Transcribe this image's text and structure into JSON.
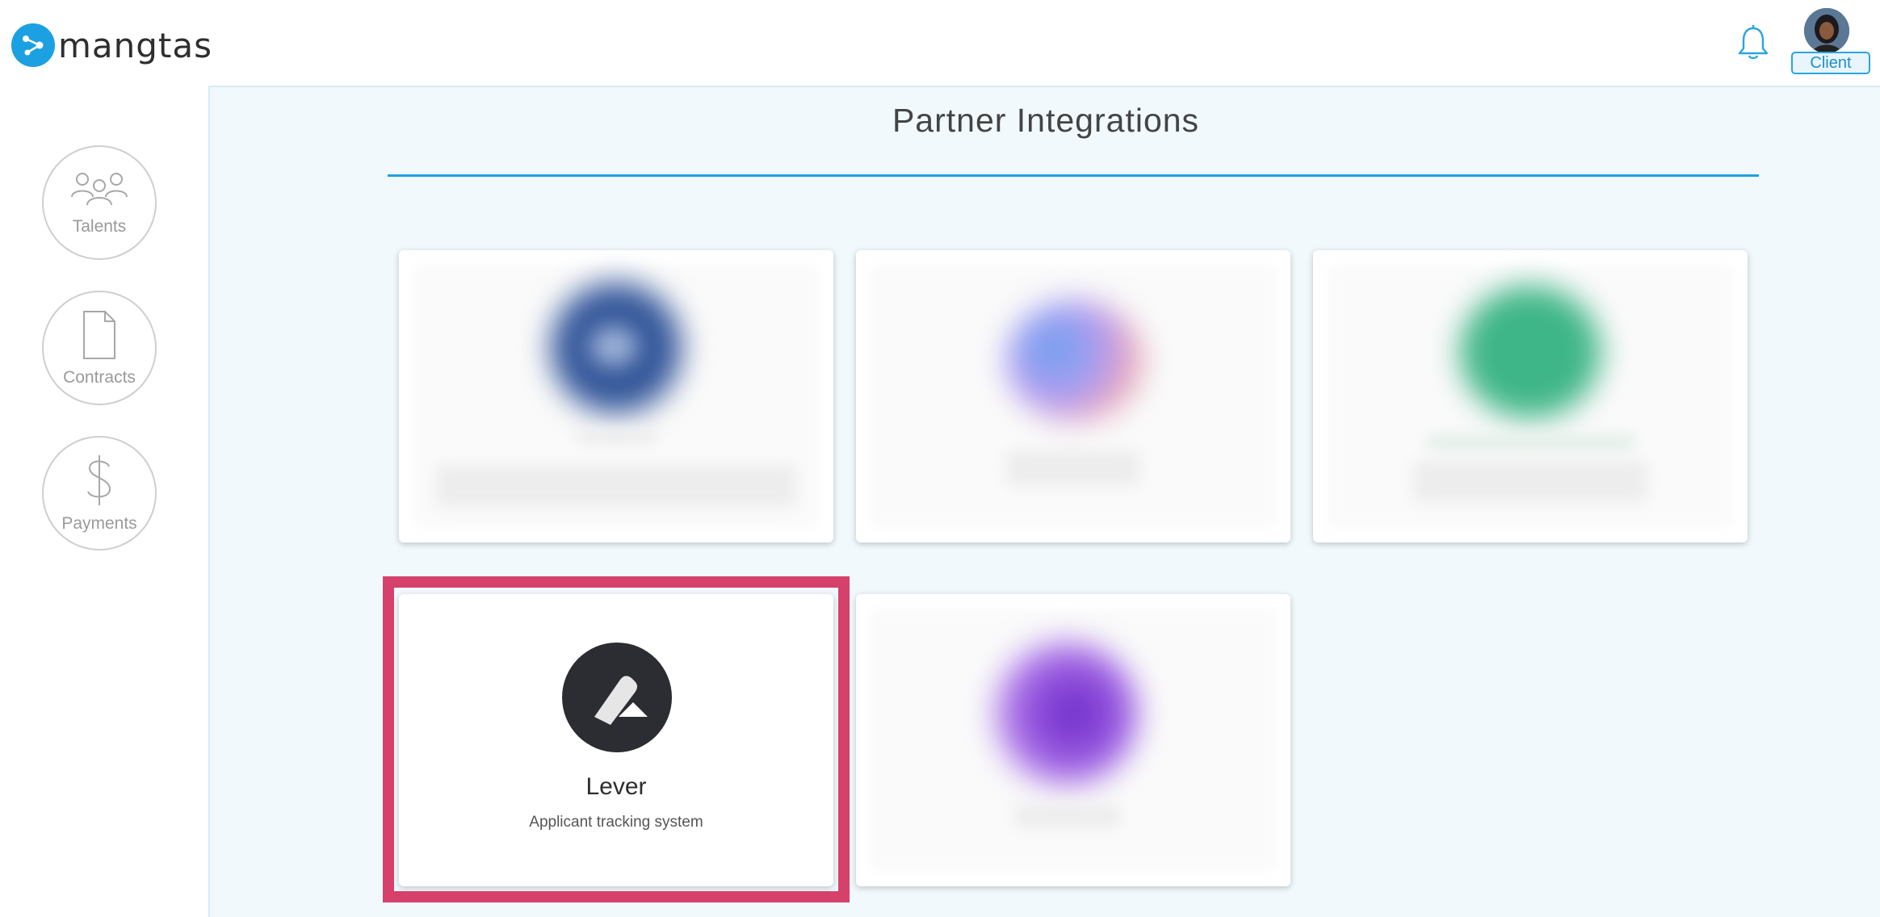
{
  "header": {
    "logo_text": "mangtas",
    "role_badge": "Client"
  },
  "sidebar": {
    "items": [
      {
        "label": "Talents",
        "icon": "people-icon"
      },
      {
        "label": "Contracts",
        "icon": "document-icon"
      },
      {
        "label": "Payments",
        "icon": "dollar-icon"
      }
    ]
  },
  "main": {
    "title": "Partner Integrations",
    "cards": [
      {
        "name": "",
        "description": "",
        "blurred": true,
        "logo_color": "#2f4f93"
      },
      {
        "name": "",
        "description": "",
        "blurred": true,
        "logo_color": "#8a7fe0"
      },
      {
        "name": "",
        "description": "",
        "blurred": true,
        "logo_color": "#2fb07d"
      },
      {
        "name": "Lever",
        "description": "Applicant tracking system",
        "blurred": false,
        "highlighted": true,
        "logo_color": "#2b2d33"
      },
      {
        "name": "",
        "description": "",
        "blurred": true,
        "logo_color": "#7a35d0"
      }
    ]
  },
  "colors": {
    "accent": "#1ba1e2",
    "highlight": "#d6416b",
    "main_background": "#f1f9fd"
  }
}
